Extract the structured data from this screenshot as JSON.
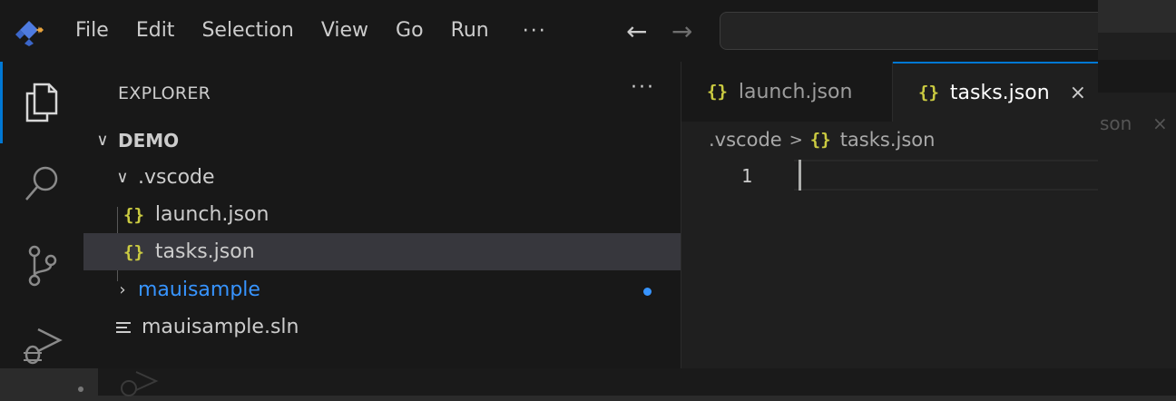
{
  "menu": [
    "File",
    "Edit",
    "Selection",
    "View",
    "Go",
    "Run"
  ],
  "menu_more": "···",
  "nav": {
    "back": "←",
    "forward": "→"
  },
  "explorer": {
    "title": "EXPLORER",
    "more": "···",
    "workspace": "DEMO",
    "folder_vscode": ".vscode",
    "file_launch": "launch.json",
    "file_tasks": "tasks.json",
    "folder_mauisample": "mauisample",
    "file_sln": "mauisample.sln"
  },
  "tabs": [
    {
      "label": "launch.json",
      "active": false
    },
    {
      "label": "tasks.json",
      "active": true
    }
  ],
  "tab_close": "×",
  "breadcrumb": {
    "folder": ".vscode",
    "sep": ">",
    "file": "tasks.json"
  },
  "editor": {
    "line_number": "1"
  },
  "json_glyph": "{}",
  "background_window": {
    "tab_fragment": "son",
    "tab_close": "×"
  },
  "colors": {
    "accent": "#0078d4",
    "json_icon": "#cbcb41",
    "folder_modified": "#3794ff"
  }
}
